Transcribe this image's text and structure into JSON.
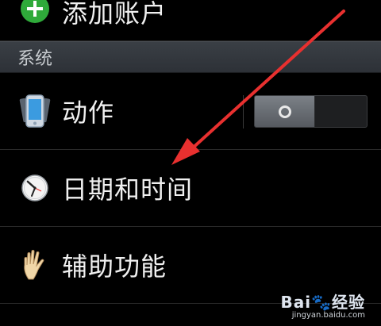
{
  "top_item": {
    "label": "添加账户"
  },
  "section": {
    "title": "系统"
  },
  "items": [
    {
      "label": "动作"
    },
    {
      "label": "日期和时间"
    },
    {
      "label": "辅助功能"
    }
  ],
  "toggle": {
    "state": "off"
  },
  "watermark": {
    "logo": "Bai",
    "logo_suffix": "经验",
    "url": "jingyan.baidu.com"
  },
  "colors": {
    "accent_arrow": "#e8302f",
    "add_icon": "#2faa3a"
  }
}
